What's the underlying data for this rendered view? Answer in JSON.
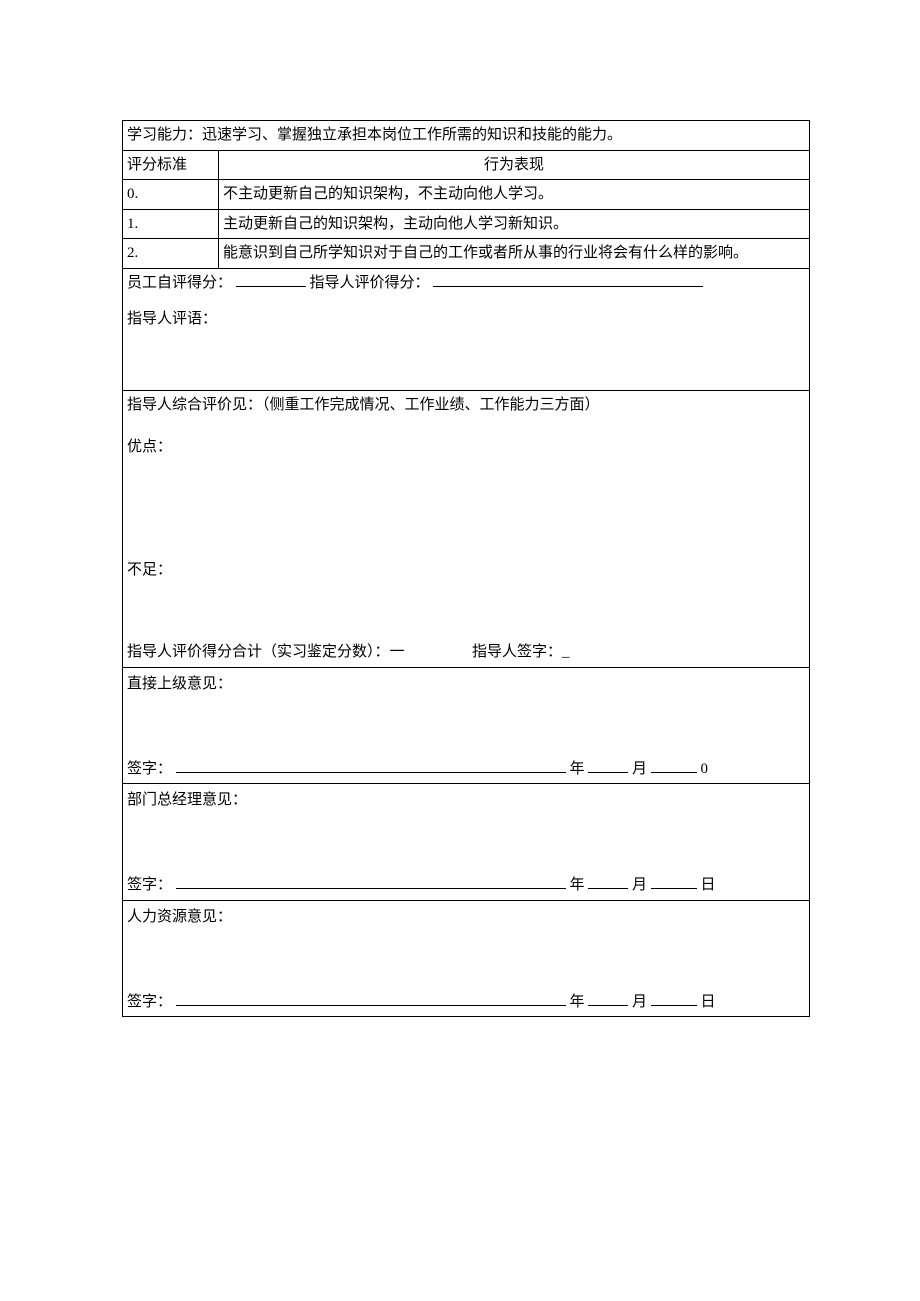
{
  "ability_title": "学习能力：迅速学习、掌握独立承担本岗位工作所需的知识和技能的能力。",
  "criteria_header_left": "评分标准",
  "criteria_header_right": "行为表现",
  "criteria": [
    {
      "score": "0.",
      "desc": "不主动更新自己的知识架构，不主动向他人学习。"
    },
    {
      "score": "1.",
      "desc": "主动更新自己的知识架构，主动向他人学习新知识。"
    },
    {
      "score": "2.",
      "desc": "能意识到自己所学知识对于自己的工作或者所从事的行业将会有什么样的影响。"
    }
  ],
  "self_score_label": "员工自评得分：",
  "mentor_score_label": "指导人评价得分：",
  "mentor_comment_label": "指导人评语：",
  "overall_label": "指导人综合评价见：（侧重工作完成情况、工作业绩、工作能力三方面）",
  "pros_label": "优点：",
  "cons_label": "不足：",
  "total_label": "指导人评价得分合计（实习鉴定分数）：一",
  "mentor_sign_label": "指导人签字：_",
  "supervisor_block": "直接上级意见：",
  "dept_block": "部门总经理意见：",
  "hr_block": "人力资源意见：",
  "sign_label": "签字：",
  "year": "年",
  "month": "月",
  "day_zero": "0",
  "day": "日"
}
